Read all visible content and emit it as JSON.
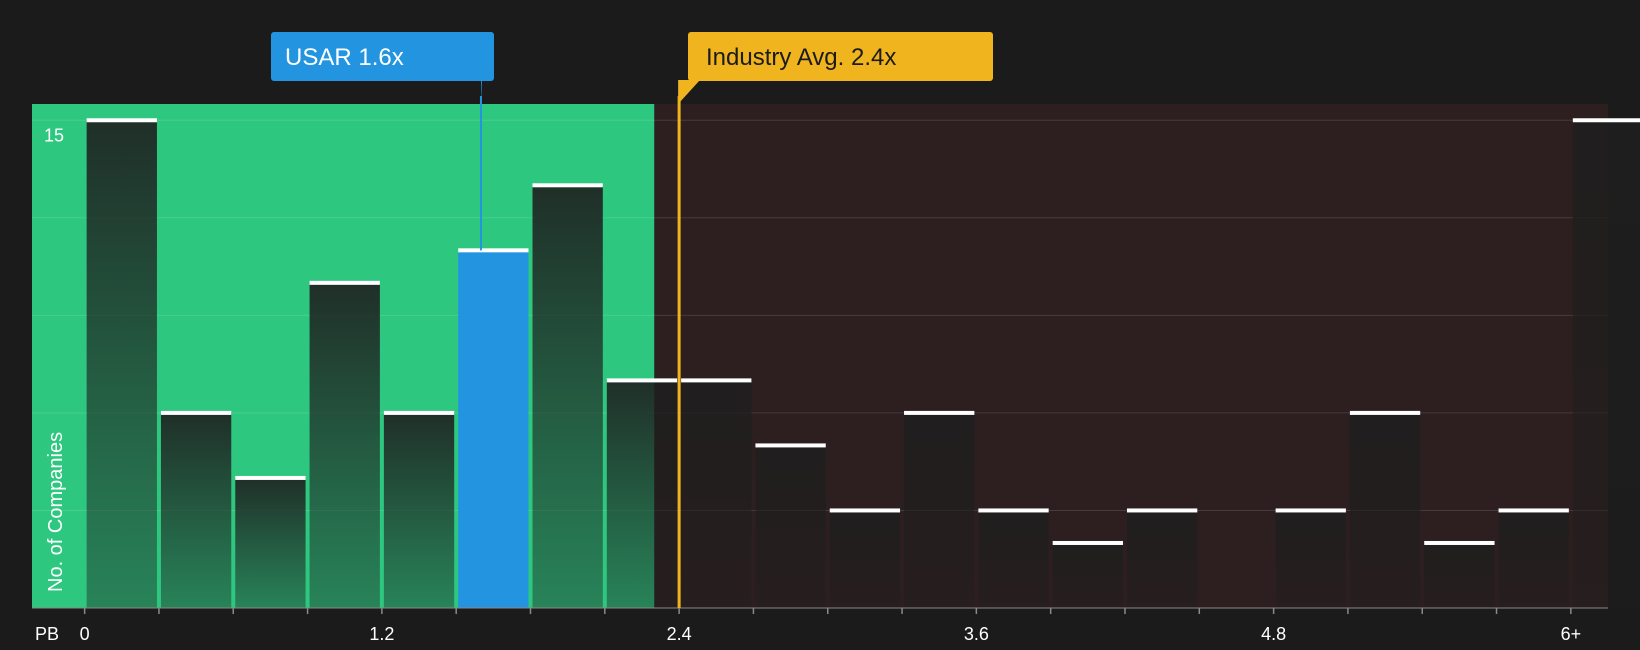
{
  "chart_data": {
    "type": "bar",
    "xlabel": "PB",
    "ylabel": "No. of Companies",
    "x_ticks": [
      "0",
      "1.2",
      "2.4",
      "3.6",
      "4.8",
      "6+"
    ],
    "x_tick_values": [
      0,
      1.2,
      2.4,
      3.6,
      4.8,
      6
    ],
    "y_ticks": [
      "15"
    ],
    "ylim": [
      0,
      15.5
    ],
    "xlim": [
      -0.2125,
      6.15
    ],
    "bin_width": 0.3,
    "bins": [
      {
        "start": 0.0,
        "value": 15,
        "highlight": false
      },
      {
        "start": 0.3,
        "value": 6,
        "highlight": false
      },
      {
        "start": 0.6,
        "value": 4,
        "highlight": false
      },
      {
        "start": 0.9,
        "value": 10,
        "highlight": false
      },
      {
        "start": 1.2,
        "value": 6,
        "highlight": false
      },
      {
        "start": 1.5,
        "value": 11,
        "highlight": true
      },
      {
        "start": 1.8,
        "value": 13,
        "highlight": false
      },
      {
        "start": 2.1,
        "value": 7,
        "highlight": false
      },
      {
        "start": 2.4,
        "value": 7,
        "highlight": false
      },
      {
        "start": 2.7,
        "value": 5,
        "highlight": false
      },
      {
        "start": 3.0,
        "value": 3,
        "highlight": false
      },
      {
        "start": 3.3,
        "value": 6,
        "highlight": false
      },
      {
        "start": 3.6,
        "value": 3,
        "highlight": false
      },
      {
        "start": 3.9,
        "value": 2,
        "highlight": false
      },
      {
        "start": 4.2,
        "value": 3,
        "highlight": false
      },
      {
        "start": 4.5,
        "value": 0,
        "highlight": false
      },
      {
        "start": 4.8,
        "value": 3,
        "highlight": false
      },
      {
        "start": 5.1,
        "value": 6,
        "highlight": false
      },
      {
        "start": 5.4,
        "value": 2,
        "highlight": false
      },
      {
        "start": 5.7,
        "value": 3,
        "highlight": false
      },
      {
        "start": 6.0,
        "value": 15,
        "highlight": false
      }
    ],
    "company": {
      "label": "USAR 1.6x",
      "value": 1.6,
      "color": "#2394e0"
    },
    "industry": {
      "label": "Industry Avg. 2.4x",
      "value": 2.4,
      "color": "#f0b41e"
    },
    "fair_zone_end": 2.3,
    "colors": {
      "background": "#1b1b1b",
      "fair_zone": "#2ec780",
      "over_zone": "#2d1e1f",
      "bar_fill": "#1e1e1e",
      "highlight_bar": "#2394e0",
      "bar_top": "#ffffff",
      "grid": "#ffffff"
    }
  }
}
